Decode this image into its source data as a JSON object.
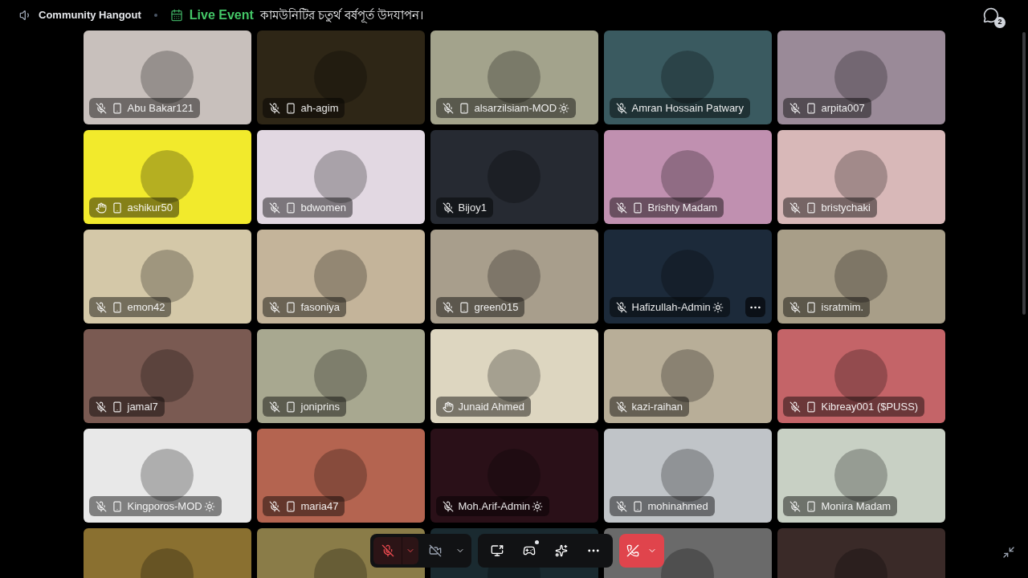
{
  "header": {
    "channel": "Community Hangout",
    "event_label": "Live Event",
    "event_title": "কামউনিটির চতুর্থ বর্ষপূর্ত উদযাপন।",
    "chat_badge": "2"
  },
  "tiles": [
    {
      "name": "Abu Bakar121",
      "color": "#c8c0bc",
      "kind": "muted",
      "mobile": true,
      "badge": false,
      "hovered": false
    },
    {
      "name": "ah-agim",
      "color": "#2e2616",
      "kind": "muted",
      "mobile": true,
      "badge": false,
      "hovered": false
    },
    {
      "name": "alsarzilsiam-MOD",
      "color": "#a3a38c",
      "kind": "muted",
      "mobile": true,
      "badge": true,
      "hovered": false
    },
    {
      "name": "Amran Hossain Patwary",
      "color": "#3a5a60",
      "kind": "muted",
      "mobile": false,
      "badge": false,
      "hovered": false
    },
    {
      "name": "arpita007",
      "color": "#9a8a98",
      "kind": "muted",
      "mobile": true,
      "badge": false,
      "hovered": false
    },
    {
      "name": "ashikur50",
      "color": "#f2ea2c",
      "kind": "hand",
      "mobile": true,
      "badge": false,
      "hovered": false
    },
    {
      "name": "bdwomen",
      "color": "#e2d8e2",
      "kind": "muted",
      "mobile": true,
      "badge": false,
      "hovered": false
    },
    {
      "name": "Bijoy1",
      "color": "#262a32",
      "kind": "muted",
      "mobile": false,
      "badge": false,
      "hovered": false
    },
    {
      "name": "Brishty Madam",
      "color": "#c090b0",
      "kind": "muted",
      "mobile": true,
      "badge": false,
      "hovered": false
    },
    {
      "name": "bristychaki",
      "color": "#d8b8b8",
      "kind": "muted",
      "mobile": true,
      "badge": false,
      "hovered": false
    },
    {
      "name": "emon42",
      "color": "#d4c8a8",
      "kind": "muted",
      "mobile": true,
      "badge": false,
      "hovered": false
    },
    {
      "name": "fasoniya",
      "color": "#c4b49a",
      "kind": "muted",
      "mobile": true,
      "badge": false,
      "hovered": false
    },
    {
      "name": "green015",
      "color": "#a89e8c",
      "kind": "muted",
      "mobile": true,
      "badge": false,
      "hovered": false
    },
    {
      "name": "Hafizullah-Admin",
      "color": "#1c2a3a",
      "kind": "muted",
      "mobile": false,
      "badge": true,
      "hovered": true
    },
    {
      "name": "isratmim.",
      "color": "#a89e88",
      "kind": "muted",
      "mobile": true,
      "badge": false,
      "hovered": false
    },
    {
      "name": "jamal7",
      "color": "#7a5a52",
      "kind": "muted",
      "mobile": true,
      "badge": false,
      "hovered": false
    },
    {
      "name": "joniprins",
      "color": "#a8a890",
      "kind": "muted",
      "mobile": true,
      "badge": false,
      "hovered": false
    },
    {
      "name": "Junaid Ahmed",
      "color": "#ddd6c0",
      "kind": "hand",
      "mobile": false,
      "badge": false,
      "hovered": false
    },
    {
      "name": "kazi-raihan",
      "color": "#b8ae98",
      "kind": "muted",
      "mobile": false,
      "badge": false,
      "hovered": false
    },
    {
      "name": "Kibreay001 ($PUSS)",
      "color": "#c46468",
      "kind": "muted",
      "mobile": true,
      "badge": false,
      "hovered": false
    },
    {
      "name": "Kingporos-MOD",
      "color": "#e8e8e8",
      "kind": "muted",
      "mobile": true,
      "badge": true,
      "hovered": false
    },
    {
      "name": "maria47",
      "color": "#b46450",
      "kind": "muted",
      "mobile": true,
      "badge": false,
      "hovered": false
    },
    {
      "name": "Moh.Arif-Admin",
      "color": "#2a1018",
      "kind": "muted",
      "mobile": false,
      "badge": true,
      "hovered": false
    },
    {
      "name": "mohinahmed",
      "color": "#c0c4c8",
      "kind": "muted",
      "mobile": true,
      "badge": false,
      "hovered": false
    },
    {
      "name": "Monira Madam",
      "color": "#c8d0c4",
      "kind": "muted",
      "mobile": true,
      "badge": false,
      "hovered": false
    },
    {
      "color": "#8a7030"
    },
    {
      "color": "#8a7c48"
    },
    {
      "color": "#1a2a30"
    },
    {
      "color": "#6a6a6a"
    },
    {
      "color": "#3a2a28"
    }
  ],
  "controls": {
    "mic_muted": true,
    "camera_off": true,
    "activity_dot": true
  }
}
